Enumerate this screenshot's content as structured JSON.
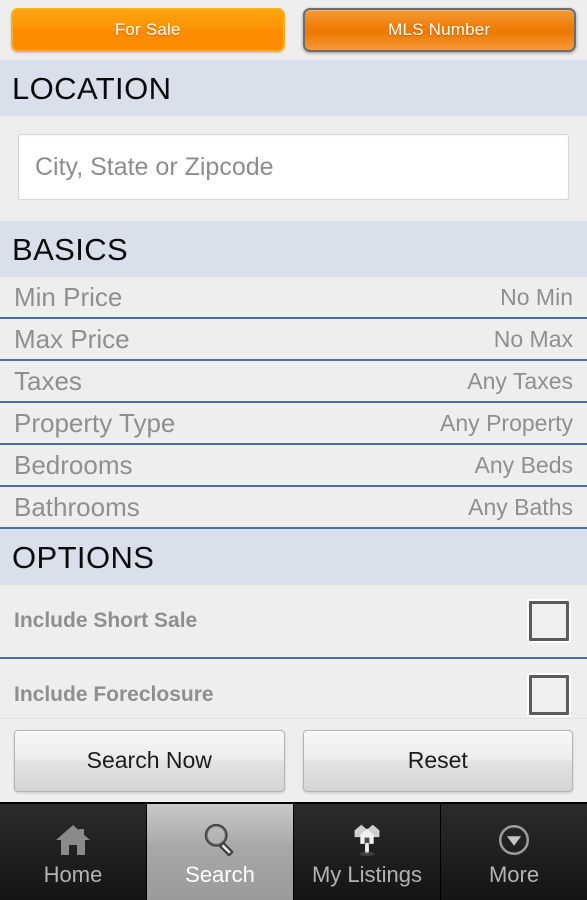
{
  "toolbar": {
    "tabs": [
      {
        "label": "For Sale",
        "selected": true
      },
      {
        "label": "MLS Number",
        "selected": false
      }
    ]
  },
  "sections": {
    "location": {
      "header": "LOCATION",
      "input_placeholder": "City, State or Zipcode",
      "input_value": ""
    },
    "basics": {
      "header": "BASICS",
      "rows": [
        {
          "label": "Min Price",
          "value": "No Min"
        },
        {
          "label": "Max Price",
          "value": "No Max"
        },
        {
          "label": "Taxes",
          "value": "Any Taxes"
        },
        {
          "label": "Property Type",
          "value": "Any Property"
        },
        {
          "label": "Bedrooms",
          "value": "Any Beds"
        },
        {
          "label": "Bathrooms",
          "value": "Any Baths"
        }
      ]
    },
    "options": {
      "header": "OPTIONS",
      "rows": [
        {
          "label": "Include Short Sale",
          "checked": false
        },
        {
          "label": "Include Foreclosure",
          "checked": false
        }
      ]
    }
  },
  "actions": {
    "search_label": "Search Now",
    "reset_label": "Reset"
  },
  "tabbar": {
    "tabs": [
      {
        "label": "Home",
        "icon": "house-icon",
        "active": false
      },
      {
        "label": "Search",
        "icon": "magnifier-icon",
        "active": true
      },
      {
        "label": "My Listings",
        "icon": "houses-cluster-icon",
        "active": false
      },
      {
        "label": "More",
        "icon": "circle-chevron-down-icon",
        "active": false
      }
    ]
  },
  "colors": {
    "accent_orange": "#fd8c00",
    "section_header_bg": "#d9dfeb",
    "row_separator": "#4a6fa8",
    "body_bg": "#eeeeee"
  }
}
